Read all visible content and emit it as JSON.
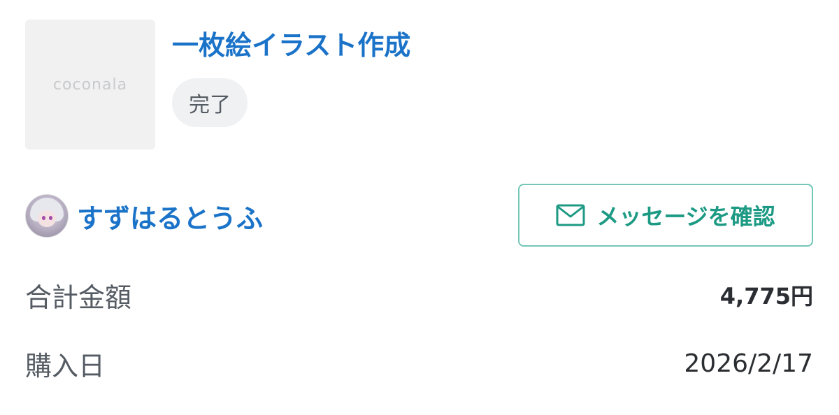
{
  "order": {
    "thumbnail_logo": "coconala",
    "service_title": "一枚絵イラスト作成",
    "status": "完了"
  },
  "seller": {
    "name": "すずはるとうふ",
    "avatar_icon": "user-avatar"
  },
  "actions": {
    "message_button_label": "メッセージを確認",
    "message_icon": "mail-icon"
  },
  "details": {
    "total_label": "合計金額",
    "total_value": "4,775円",
    "purchase_date_label": "購入日",
    "purchase_date_value": "2026/2/17"
  },
  "colors": {
    "link_blue": "#1a73c8",
    "accent_green": "#1d9a84",
    "button_border": "#74c6b6"
  }
}
